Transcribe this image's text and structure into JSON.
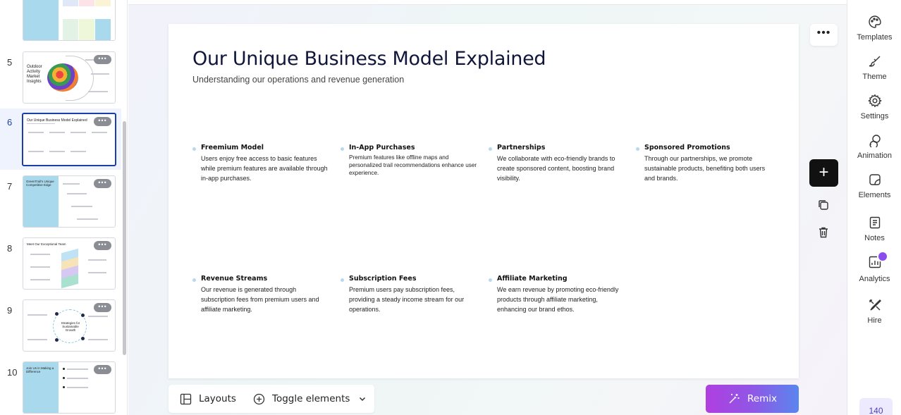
{
  "sidebar": {
    "slides": [
      {
        "num": "",
        "title": ""
      },
      {
        "num": "5",
        "title": "Outdoor Activity Market Insights"
      },
      {
        "num": "6",
        "title": "Our Unique Business Model Explained"
      },
      {
        "num": "7",
        "title": "GreenTrail's Unique Competitive Edge"
      },
      {
        "num": "8",
        "title": "Meet Our Exceptional Team"
      },
      {
        "num": "9",
        "title": "Strategies for Sustainable Growth"
      },
      {
        "num": "10",
        "title": "Join Us in Making a Difference"
      }
    ],
    "more_label": "•••"
  },
  "slide": {
    "title": "Our Unique Business Model Explained",
    "subtitle": "Understanding our operations and revenue generation",
    "items": [
      {
        "title": "Freemium Model",
        "text": "Users enjoy free access to basic features while premium features are available through in-app purchases."
      },
      {
        "title": "In-App Purchases",
        "text": "Premium features like offline maps and personalized trail recommendations enhance user experience."
      },
      {
        "title": "Partnerships",
        "text": "We collaborate with eco-friendly brands to create sponsored content, boosting brand visibility."
      },
      {
        "title": "Sponsored Promotions",
        "text": "Through our partnerships, we promote sustainable products, benefiting both users and brands."
      },
      {
        "title": "Revenue Streams",
        "text": "Our revenue is generated through subscription fees from premium users and affiliate marketing."
      },
      {
        "title": "Subscription Fees",
        "text": "Premium users pay subscription fees, providing a steady income stream for our operations."
      },
      {
        "title": "Affiliate Marketing",
        "text": "We earn revenue by promoting eco-friendly products through affiliate marketing, enhancing our brand ethos."
      }
    ]
  },
  "canvas": {
    "more_label": "•••",
    "add_label": "+",
    "layouts_label": "Layouts",
    "toggle_label": "Toggle elements",
    "remix_label": "Remix"
  },
  "toolbar": {
    "templates": "Templates",
    "theme": "Theme",
    "settings": "Settings",
    "animation": "Animation",
    "elements": "Elements",
    "notes": "Notes",
    "analytics": "Analytics",
    "hire": "Hire",
    "credits": "140"
  },
  "colors": {
    "accent": "#1b3fa8",
    "remix_start": "#b13ee0",
    "remix_end": "#5a86ee",
    "bullet": "#b9d8ec"
  }
}
